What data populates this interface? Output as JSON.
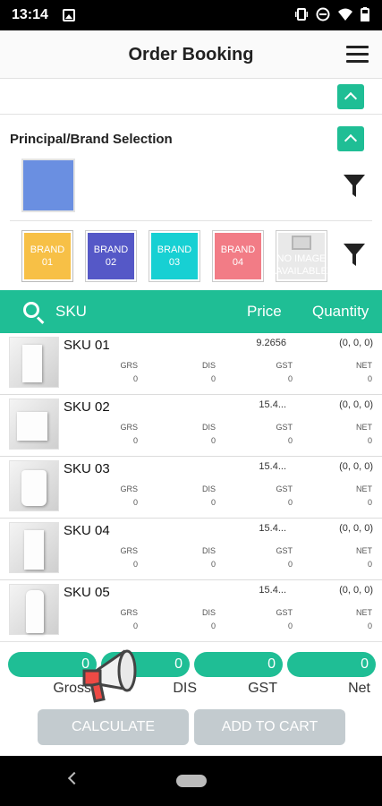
{
  "status_bar": {
    "time": "13:14"
  },
  "app_bar": {
    "title": "Order Booking"
  },
  "brand_section": {
    "label": "Principal/Brand Selection",
    "principal_color": "#6a8fe1",
    "brands": [
      {
        "label_line1": "BRAND",
        "label_line2": "01",
        "color": "#f7c046"
      },
      {
        "label_line1": "BRAND",
        "label_line2": "02",
        "color": "#5558c7"
      },
      {
        "label_line1": "BRAND",
        "label_line2": "03",
        "color": "#17d0d3"
      },
      {
        "label_line1": "BRAND",
        "label_line2": "04",
        "color": "#f27c86"
      }
    ],
    "no_image_text": "NO IMAGE AVAILABLE"
  },
  "sku_header": {
    "search_label": "SKU",
    "price_label": "Price",
    "quantity_label": "Quantity"
  },
  "sku_items": [
    {
      "name": "SKU 01",
      "price": "9.2656",
      "qty": "(0, 0, 0)",
      "grs": "0",
      "dis": "0",
      "gst": "0",
      "net": "0"
    },
    {
      "name": "SKU 02",
      "price": "15.4...",
      "qty": "(0, 0, 0)",
      "grs": "0",
      "dis": "0",
      "gst": "0",
      "net": "0"
    },
    {
      "name": "SKU 03",
      "price": "15.4...",
      "qty": "(0, 0, 0)",
      "grs": "0",
      "dis": "0",
      "gst": "0",
      "net": "0"
    },
    {
      "name": "SKU 04",
      "price": "15.4...",
      "qty": "(0, 0, 0)",
      "grs": "0",
      "dis": "0",
      "gst": "0",
      "net": "0"
    },
    {
      "name": "SKU 05",
      "price": "15.4...",
      "qty": "(0, 0, 0)",
      "grs": "0",
      "dis": "0",
      "gst": "0",
      "net": "0"
    }
  ],
  "column_labels": {
    "grs": "GRS",
    "dis": "DIS",
    "gst": "GST",
    "net": "NET"
  },
  "totals": [
    {
      "label": "Gross",
      "value": "0"
    },
    {
      "label": "DIS",
      "value": "0"
    },
    {
      "label": "GST",
      "value": "0"
    },
    {
      "label": "Net",
      "value": "0"
    }
  ],
  "actions": {
    "calculate": "CALCULATE",
    "add_to_cart": "ADD TO CART"
  },
  "colors": {
    "accent": "#1fbe95",
    "button_disabled": "#c3cbcf"
  }
}
